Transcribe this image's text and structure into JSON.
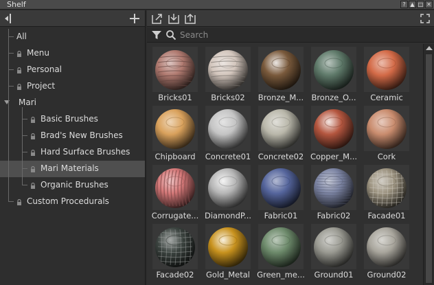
{
  "window": {
    "title": "Shelf"
  },
  "search": {
    "placeholder": "Search"
  },
  "tree": [
    {
      "label": "All",
      "level": 0,
      "locked": false,
      "selected": false
    },
    {
      "label": "Menu",
      "level": 0,
      "locked": true,
      "selected": false
    },
    {
      "label": "Personal",
      "level": 0,
      "locked": true,
      "selected": false
    },
    {
      "label": "Project",
      "level": 0,
      "locked": true,
      "selected": false
    },
    {
      "label": "Mari",
      "level": 0,
      "locked": false,
      "selected": false,
      "expanded": true
    },
    {
      "label": "Basic Brushes",
      "level": 1,
      "locked": true,
      "selected": false
    },
    {
      "label": "Brad's New Brushes",
      "level": 1,
      "locked": true,
      "selected": false
    },
    {
      "label": "Hard Surface Brushes",
      "level": 1,
      "locked": true,
      "selected": false
    },
    {
      "label": "Mari Materials",
      "level": 1,
      "locked": true,
      "selected": true
    },
    {
      "label": "Organic Brushes",
      "level": 1,
      "locked": true,
      "selected": false
    },
    {
      "label": "Custom Procedurals",
      "level": 0,
      "locked": true,
      "selected": false
    }
  ],
  "materials": [
    {
      "label": "Bricks01",
      "color": "#b07a70",
      "pattern": "brick"
    },
    {
      "label": "Bricks02",
      "color": "#d3c6bd",
      "pattern": "brick"
    },
    {
      "label": "Bronze_M...",
      "color": "#7a5a3c",
      "pattern": "metal"
    },
    {
      "label": "Bronze_O...",
      "color": "#5f7a6a",
      "pattern": "rough"
    },
    {
      "label": "Ceramic",
      "color": "#d36a47",
      "pattern": "rough"
    },
    {
      "label": "Chipboard",
      "color": "#d9a15c",
      "pattern": "rough"
    },
    {
      "label": "Concrete01",
      "color": "#c4c4c4",
      "pattern": "rough"
    },
    {
      "label": "Concrete02",
      "color": "#b9b7aa",
      "pattern": "rough"
    },
    {
      "label": "Copper_M...",
      "color": "#b4563f",
      "pattern": "metal"
    },
    {
      "label": "Cork",
      "color": "#c98c6e",
      "pattern": "rough"
    },
    {
      "label": "Corrugate...",
      "color": "#d47878",
      "pattern": "stripe"
    },
    {
      "label": "DiamondP...",
      "color": "#b5b5b5",
      "pattern": "metal"
    },
    {
      "label": "Fabric01",
      "color": "#55659c",
      "pattern": "rough"
    },
    {
      "label": "Fabric02",
      "color": "#7c84a3",
      "pattern": "weave"
    },
    {
      "label": "Facade01",
      "color": "#9c9380",
      "pattern": "grid"
    },
    {
      "label": "Facade02",
      "color": "#3c4440",
      "pattern": "grid"
    },
    {
      "label": "Gold_Metal",
      "color": "#c8921e",
      "pattern": "metal"
    },
    {
      "label": "Green_me...",
      "color": "#6d8a6b",
      "pattern": "rough"
    },
    {
      "label": "Ground01",
      "color": "#9a9a92",
      "pattern": "rough"
    },
    {
      "label": "Ground02",
      "color": "#a8a59c",
      "pattern": "rough"
    }
  ]
}
